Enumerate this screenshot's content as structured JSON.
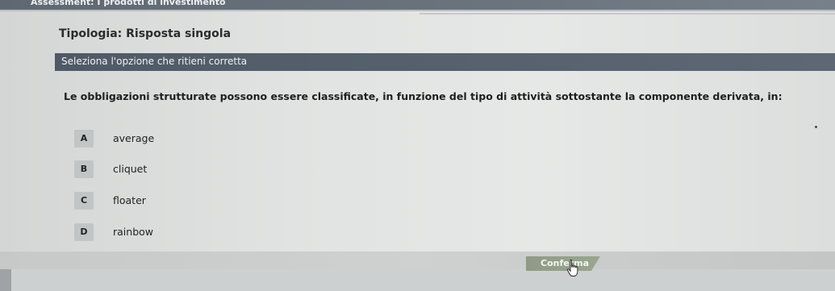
{
  "header": {
    "assessment_title": "Assessment: I prodotti di investimento"
  },
  "tipologia": "Tipologia: Risposta singola",
  "instruction": "Seleziona l'opzione che ritieni corretta",
  "question": "Le obbligazioni strutturate possono essere classificate, in funzione del tipo di attività sottostante la componente derivata, in:",
  "options": [
    {
      "letter": "A",
      "text": "average"
    },
    {
      "letter": "B",
      "text": "cliquet"
    },
    {
      "letter": "C",
      "text": "floater"
    },
    {
      "letter": "D",
      "text": "rainbow"
    }
  ],
  "footer": {
    "confirm_label": "Conferma"
  },
  "icons": {
    "cursor": "hand-pointer-icon"
  },
  "colors": {
    "instruction_bar": "#56616d",
    "confirm_button": "#94a08b",
    "option_letter_bg": "#c2c5c6"
  }
}
